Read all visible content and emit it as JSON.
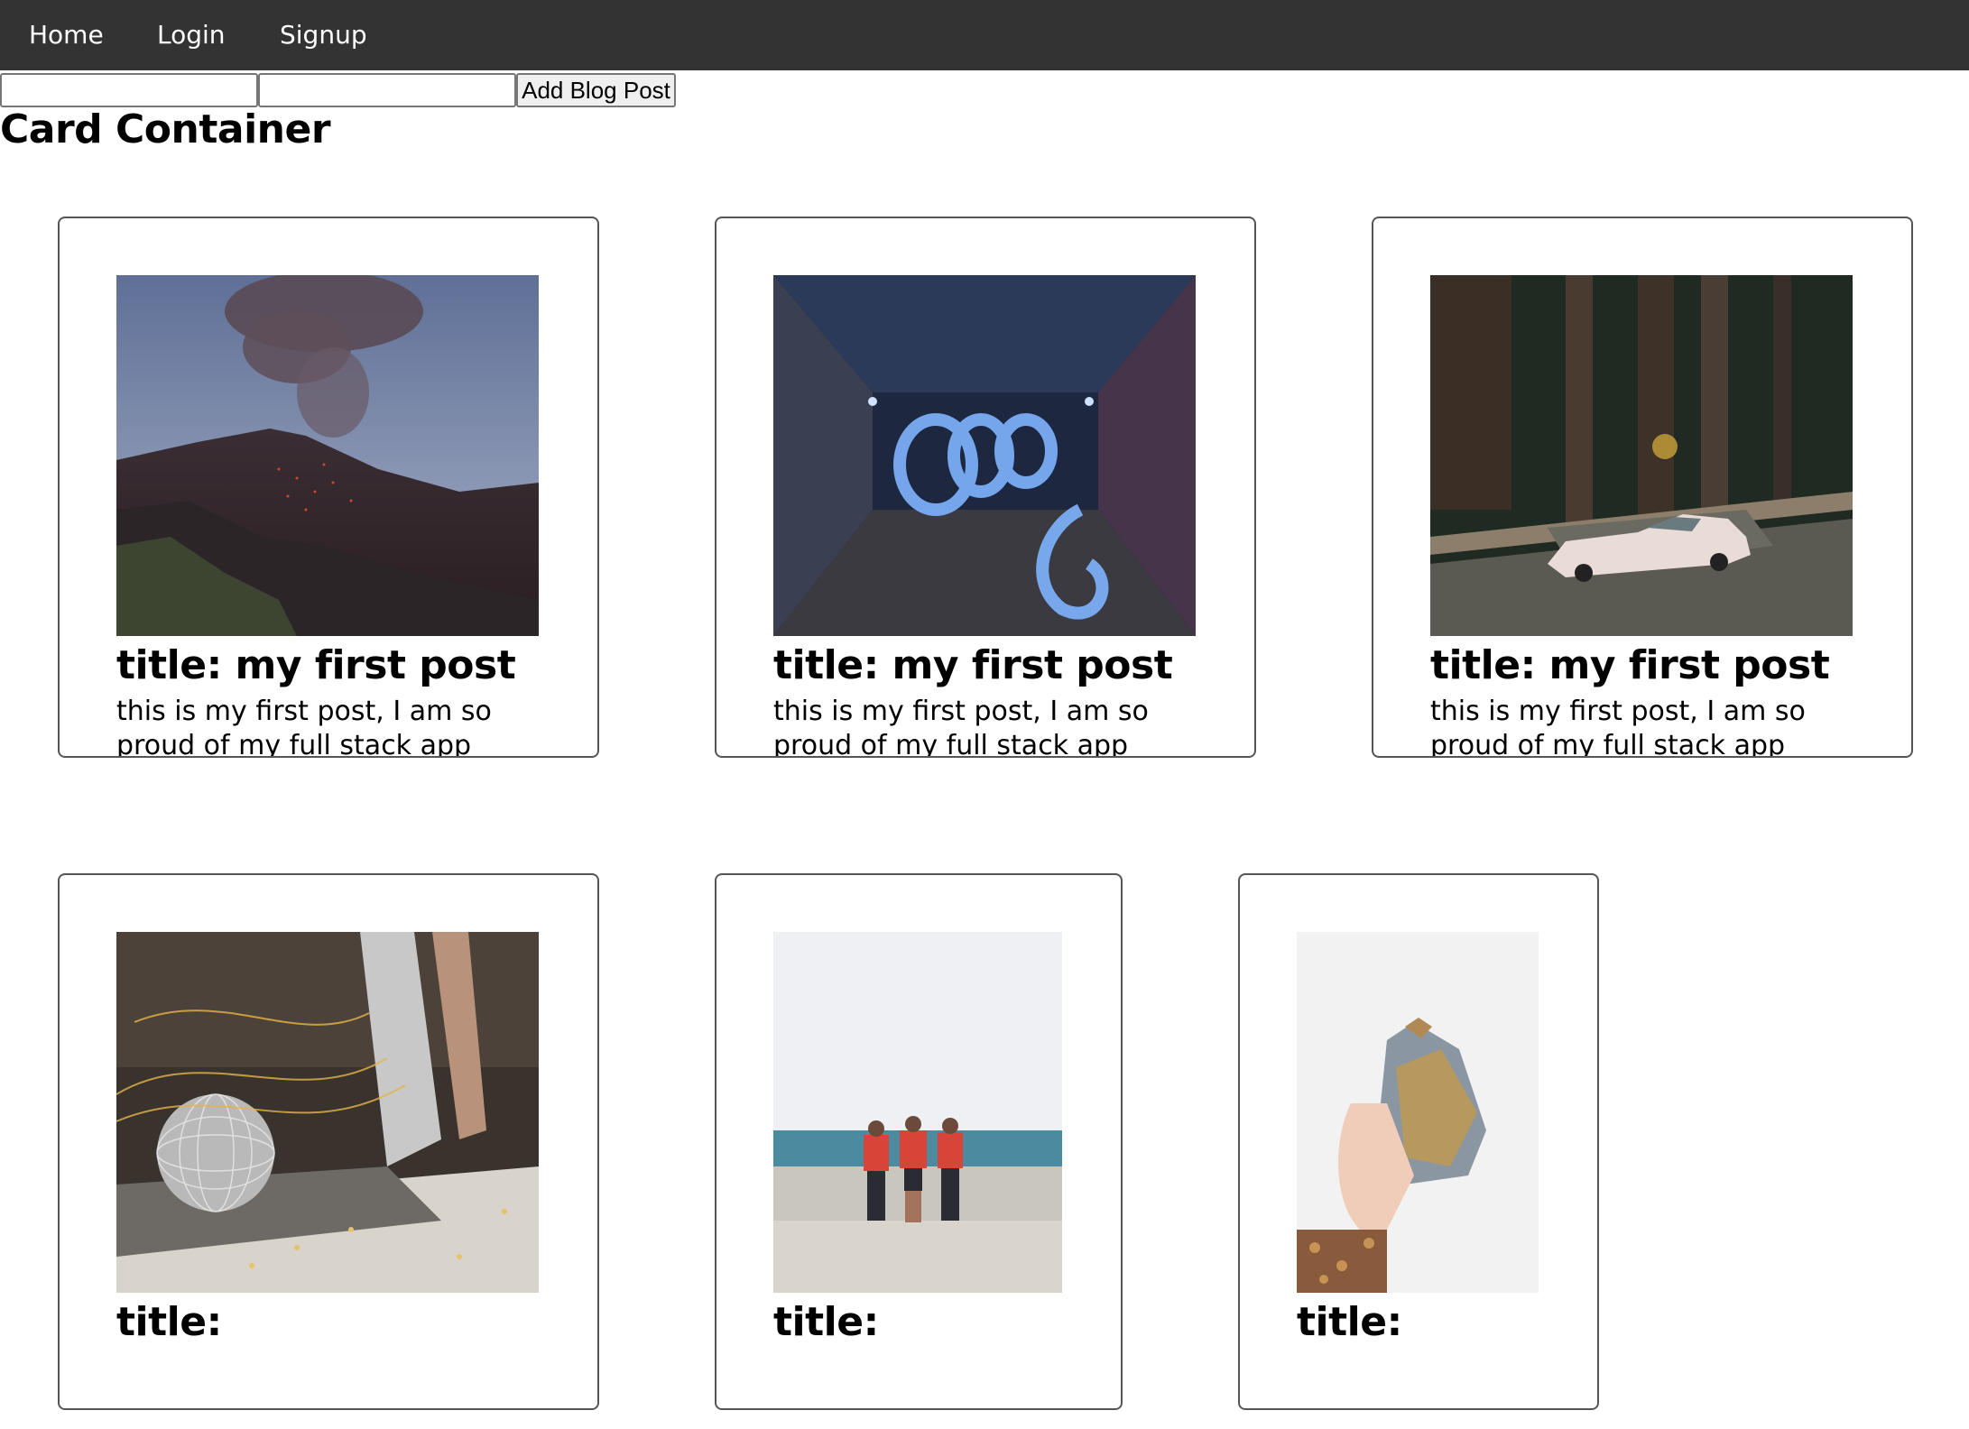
{
  "nav": {
    "links": [
      "Home",
      "Login",
      "Signup"
    ]
  },
  "form": {
    "title_input_value": "",
    "body_input_value": "",
    "submit_label": "Add Blog Post"
  },
  "page": {
    "heading": "Card Container"
  },
  "cards": [
    {
      "title": "title: my first post",
      "body": "this is my first post, I am so proud of my full stack app",
      "image": "volcano-photo"
    },
    {
      "title": "title: my first post",
      "body": "this is my first post, I am so proud of my full stack app",
      "image": "light-painting-tunnel-photo"
    },
    {
      "title": "title: my first post",
      "body": "this is my first post, I am so proud of my full stack app",
      "image": "white-car-forest-photo"
    },
    {
      "title": "title:",
      "body": "",
      "image": "disco-ball-party-photo"
    },
    {
      "title": "title:",
      "body": "",
      "image": "three-men-seawall-photo"
    },
    {
      "title": "title:",
      "body": "",
      "image": "ceramic-vase-hand-photo"
    }
  ],
  "colors": {
    "navbar_bg": "#333333",
    "nav_text": "#ffffff",
    "card_border": "#555555"
  }
}
